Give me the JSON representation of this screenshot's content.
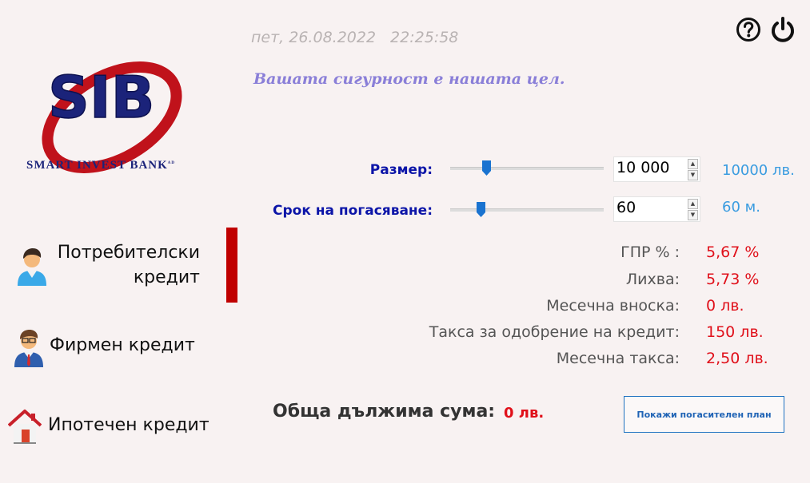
{
  "header": {
    "date": "пет, 26.08.2022",
    "time": "22:25:58",
    "slogan": "Вашата сигурност е нашата цел."
  },
  "brand": {
    "logo_initials": "SIB",
    "name_line": "SMART INVEST BANK",
    "suffix": "AD",
    "colors": {
      "red": "#c0121b",
      "blue": "#1b237a"
    }
  },
  "toolbar": {
    "help_icon": "question-circle-icon",
    "power_icon": "power-icon"
  },
  "sidebar": {
    "items": [
      {
        "label_line1": "Потребителски",
        "label_line2": "кредит",
        "icon": "person-icon",
        "active": true
      },
      {
        "label": "Фирмен кредит",
        "icon": "businessman-icon",
        "active": false
      },
      {
        "label": "Ипотечен кредит",
        "icon": "house-icon",
        "active": false
      }
    ],
    "active_color": "#c00000"
  },
  "form": {
    "amount": {
      "label": "Размер:",
      "value": "10 000",
      "echo": "10000 лв.",
      "slider_fraction": 0.22
    },
    "term": {
      "label": "Срок на погасяване:",
      "value": "60",
      "echo": "60 м.",
      "slider_fraction": 0.18
    }
  },
  "results": [
    {
      "label": "ГПР % :",
      "value": "5,67 %"
    },
    {
      "label": "Лихва:",
      "value": "5,73 %"
    },
    {
      "label": "Месечна вноска:",
      "value": "0 лв."
    },
    {
      "label": "Такса за одобрение на кредит:",
      "value": "150 лв."
    },
    {
      "label": "Месечна такса:",
      "value": "2,50 лв."
    }
  ],
  "total": {
    "label": "Обща дължима сума:",
    "value": "0 лв."
  },
  "buttons": {
    "plan": "Покажи погасителен план"
  },
  "accent_colors": {
    "label_blue": "#0c15a8",
    "value_red": "#e0101a",
    "echo_blue": "#3a9ce0"
  }
}
